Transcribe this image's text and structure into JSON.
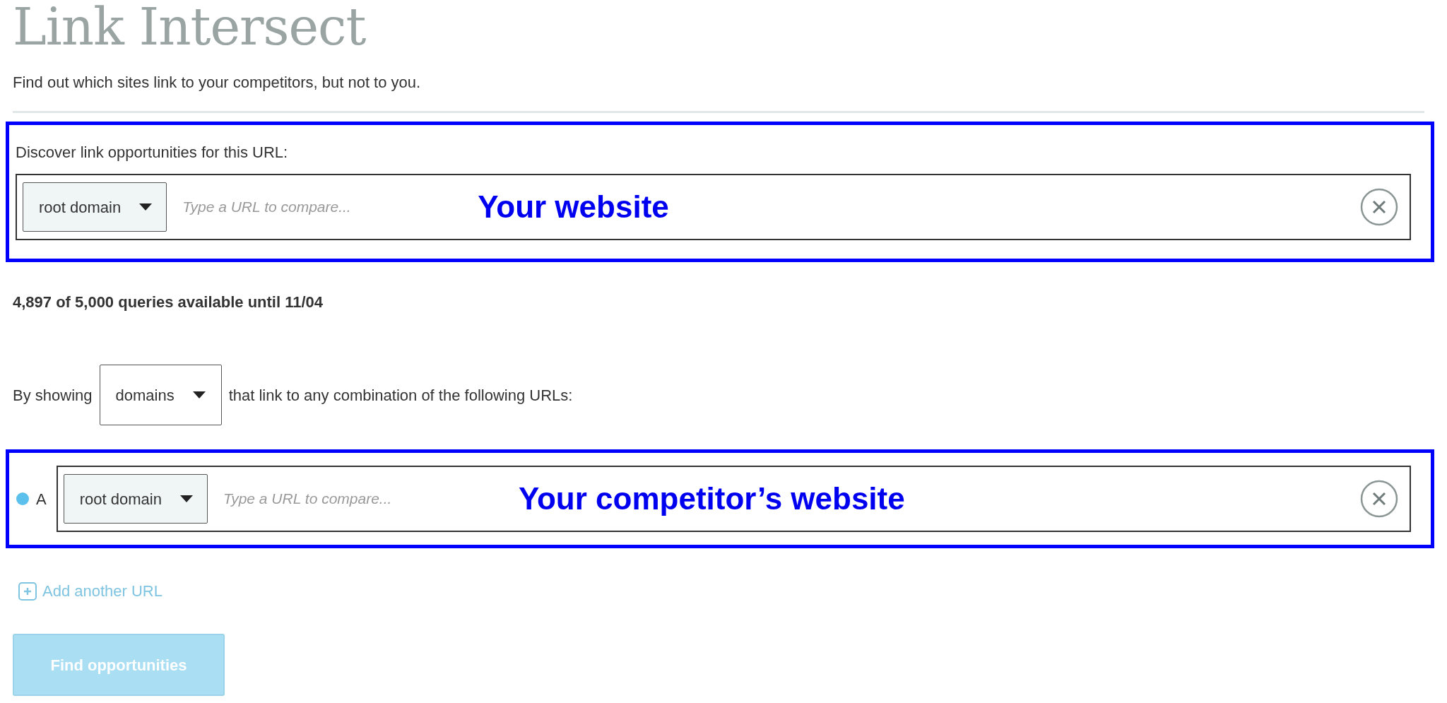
{
  "title": "Link Intersect",
  "subtitle": "Find out which sites link to your competitors, but not to you.",
  "target": {
    "label": "Discover link opportunities for this URL:",
    "scope": "root domain",
    "placeholder": "Type a URL to compare...",
    "annotation": "Your website"
  },
  "quota": "4,897 of 5,000 queries available until 11/04",
  "filter": {
    "prefix": "By showing",
    "mode": "domains",
    "suffix": "that link to any combination of the following URLs:"
  },
  "competitors": [
    {
      "letter": "A",
      "color": "#5bc0eb",
      "scope": "root domain",
      "placeholder": "Type a URL to compare...",
      "annotation": "Your competitor’s website"
    }
  ],
  "add_link": "Add another URL",
  "submit": {
    "label": "Find opportunities",
    "disabled": true
  }
}
